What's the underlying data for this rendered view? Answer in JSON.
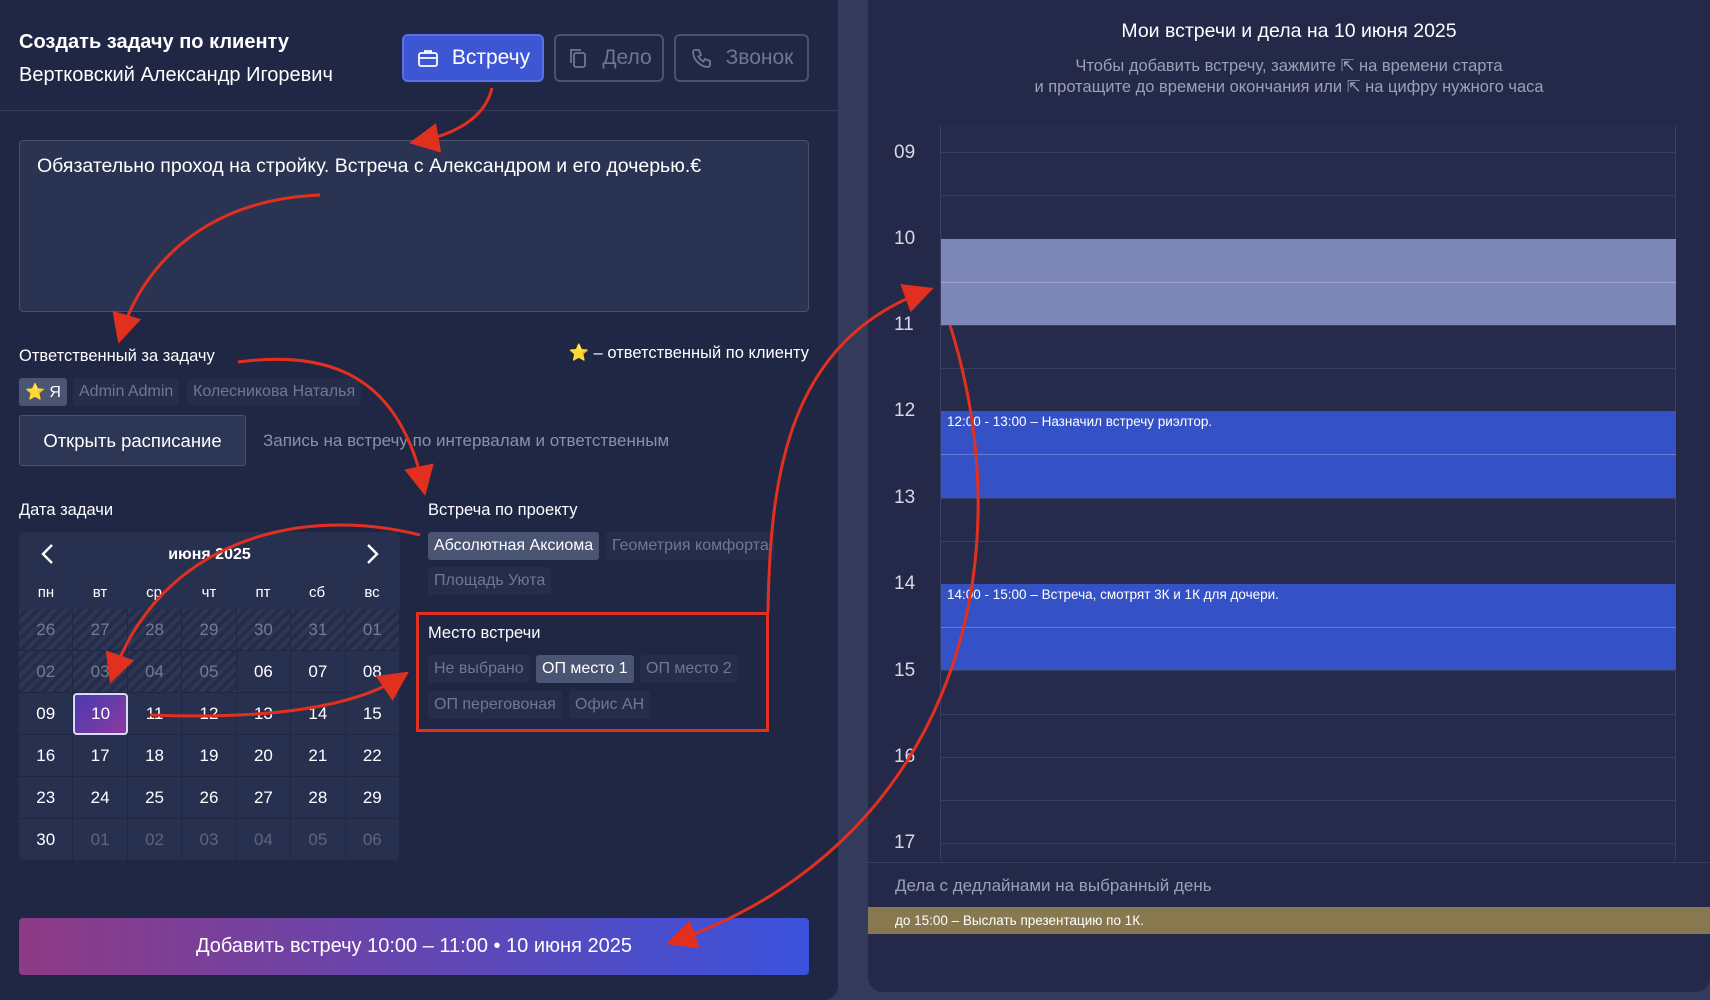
{
  "header": {
    "title": "Создать задачу по клиенту",
    "client": "Вертковский Александр Игоревич",
    "types": [
      "Встречу",
      "Дело",
      "Звонок"
    ]
  },
  "task_text": "Обязательно проход на стройку. Встреча с Александром и его дочерью.€",
  "responsible": {
    "label": "Ответственный за задачу",
    "note": "⭐ – ответственный по клиенту",
    "chips": [
      "⭐ Я",
      "Admin Admin",
      "Колесникова Наталья"
    ],
    "open_button": "Открыть расписание",
    "open_hint": "Запись на встречу по интервалам и ответственным"
  },
  "date": {
    "label": "Дата задачи",
    "month": "июня 2025",
    "weekdays": [
      "пн",
      "вт",
      "ср",
      "чт",
      "пт",
      "сб",
      "вс"
    ],
    "days": [
      "26",
      "27",
      "28",
      "29",
      "30",
      "31",
      "01",
      "02",
      "03",
      "04",
      "05",
      "06",
      "07",
      "08",
      "09",
      "10",
      "11",
      "12",
      "13",
      "14",
      "15",
      "16",
      "17",
      "18",
      "19",
      "20",
      "21",
      "22",
      "23",
      "24",
      "25",
      "26",
      "27",
      "28",
      "29",
      "30",
      "01",
      "02",
      "03",
      "04",
      "05",
      "06"
    ]
  },
  "project": {
    "label": "Встреча по проекту",
    "options": [
      "Абсолютная Аксиома",
      "Геометрия комфорта",
      "Площадь Уюта"
    ]
  },
  "place": {
    "label": "Место встречи",
    "options": [
      "Не выбрано",
      "ОП место 1",
      "ОП место 2",
      "ОП переговоная",
      "Офис АН"
    ]
  },
  "add_button": "Добавить встречу 10:00 – 11:00 • 10 июня 2025",
  "schedule": {
    "title": "Мои встречи и дела на 10 июня 2025",
    "hint1": "Чтобы добавить встречу, зажмите ⇱ на времени старта",
    "hint2": "и протащите до времени окончания или ⇱ на цифру нужного часа",
    "hours": [
      "09",
      "10",
      "11",
      "12",
      "13",
      "14",
      "15",
      "16",
      "17"
    ],
    "events": [
      "12:00 - 13:00 – Назначил встречу риэлтор.",
      "14:00 - 15:00 – Встреча, смотрят 3К и 1К для дочери."
    ],
    "deadlines_label": "Дела с дедлайнами на выбранный день",
    "deadline_item": "до 15:00 – Выслать презентацию по 1К."
  },
  "colors": {
    "accent": "#3d56d4",
    "panel": "#1f2744",
    "arrow": "#e2301f",
    "event": "#3451c6",
    "deadline": "#87784f"
  }
}
